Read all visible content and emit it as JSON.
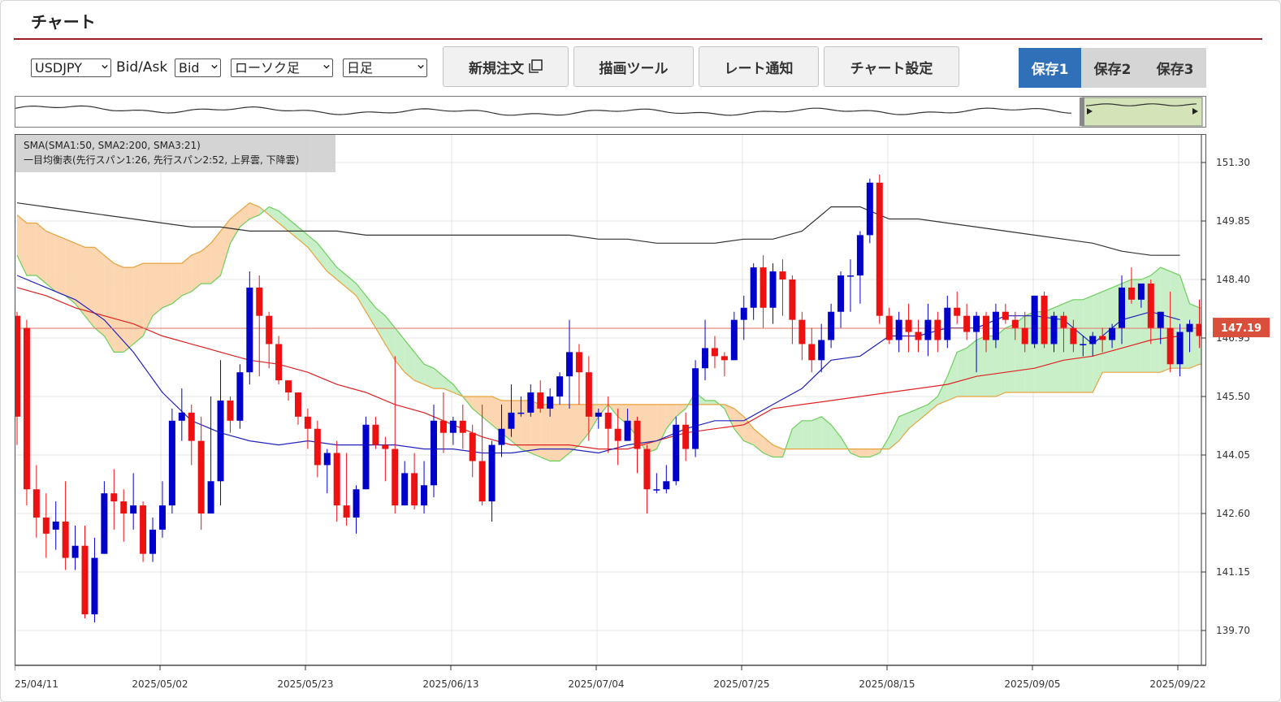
{
  "page": {
    "title": "チャート"
  },
  "toolbar": {
    "symbol": "USDJPY",
    "bid_ask_label": "Bid/Ask",
    "price_side": "Bid",
    "chart_type": "ローソク足",
    "period": "日足",
    "new_order": "新規注文",
    "drawing_tools": "描画ツール",
    "rate_alert": "レート通知",
    "chart_settings": "チャート設定",
    "save1": "保存1",
    "save2": "保存2",
    "save3": "保存3"
  },
  "legend": {
    "line1": "SMA(SMA1:50, SMA2:200, SMA3:21)",
    "line2": "一目均衡表(先行スパン1:26, 先行スパン2:52, 上昇雲, 下降雲)"
  },
  "colors": {
    "up": "#0000cc",
    "down": "#ee1111",
    "accent": "#3070b8",
    "title_rule": "#a01c1c",
    "price_tag": "#d94f3b",
    "sma50": "#dd2222",
    "sma200": "#333333",
    "sma21": "#2222bb",
    "cloud_up": "#c8efc8",
    "cloud_down": "#fbd6b0"
  },
  "chart_data": {
    "type": "candlestick",
    "symbol": "USDJPY",
    "timeframe": "日足",
    "current_price": "147.19",
    "y_ticks": [
      "151.30",
      "149.85",
      "148.40",
      "146.95",
      "145.50",
      "144.05",
      "142.60",
      "141.15",
      "139.70"
    ],
    "x_ticks": [
      "2025/04/11",
      "2025/05/02",
      "2025/05/23",
      "2025/06/13",
      "2025/07/04",
      "2025/07/25",
      "2025/08/15",
      "2025/09/05",
      "2025/09/22"
    ],
    "ylim": [
      139.3,
      151.6
    ],
    "candles": [
      [
        147.5,
        145.0,
        147.6,
        144.3
      ],
      [
        147.2,
        143.2,
        147.4,
        142.8
      ],
      [
        143.2,
        142.5,
        143.8,
        142.0
      ],
      [
        142.5,
        142.1,
        143.1,
        141.5
      ],
      [
        142.2,
        142.4,
        142.9,
        141.7
      ],
      [
        142.4,
        141.5,
        143.4,
        141.2
      ],
      [
        141.5,
        141.8,
        142.3,
        141.2
      ],
      [
        141.8,
        140.1,
        142.3,
        140.0
      ],
      [
        140.1,
        141.5,
        142.0,
        139.9
      ],
      [
        141.6,
        143.1,
        143.4,
        141.6
      ],
      [
        143.1,
        142.9,
        143.7,
        142.2
      ],
      [
        142.9,
        142.6,
        143.2,
        141.9
      ],
      [
        142.6,
        142.8,
        143.6,
        142.2
      ],
      [
        142.8,
        141.6,
        142.9,
        141.4
      ],
      [
        141.6,
        142.2,
        142.5,
        141.4
      ],
      [
        142.2,
        142.8,
        143.4,
        142.0
      ],
      [
        142.8,
        144.9,
        145.2,
        142.6
      ],
      [
        144.9,
        145.1,
        145.7,
        144.4
      ],
      [
        145.1,
        144.4,
        145.3,
        143.8
      ],
      [
        144.4,
        142.6,
        145.0,
        142.2
      ],
      [
        142.6,
        143.4,
        145.5,
        142.6
      ],
      [
        143.4,
        145.4,
        146.4,
        142.8
      ],
      [
        145.4,
        144.9,
        145.5,
        144.6
      ],
      [
        144.9,
        146.1,
        146.3,
        144.7
      ],
      [
        146.1,
        148.2,
        148.6,
        145.8
      ],
      [
        148.2,
        147.5,
        148.5,
        146.0
      ],
      [
        147.5,
        146.8,
        147.6,
        146.2
      ],
      [
        146.8,
        145.9,
        147.0,
        145.8
      ],
      [
        145.9,
        145.6,
        145.9,
        145.4
      ],
      [
        145.6,
        145.0,
        145.6,
        144.8
      ],
      [
        145.0,
        144.7,
        145.2,
        144.2
      ],
      [
        144.7,
        143.8,
        144.9,
        143.5
      ],
      [
        143.8,
        144.1,
        144.2,
        143.1
      ],
      [
        144.1,
        142.8,
        144.4,
        142.4
      ],
      [
        142.8,
        142.5,
        144.1,
        142.3
      ],
      [
        142.5,
        143.2,
        143.3,
        142.1
      ],
      [
        143.2,
        144.8,
        145.0,
        143.2
      ],
      [
        144.8,
        144.3,
        145.0,
        144.2
      ],
      [
        144.3,
        144.2,
        144.5,
        143.4
      ],
      [
        144.2,
        142.8,
        146.5,
        142.6
      ],
      [
        142.8,
        143.6,
        143.9,
        142.8
      ],
      [
        143.6,
        142.8,
        144.1,
        142.7
      ],
      [
        142.8,
        143.3,
        143.9,
        142.6
      ],
      [
        143.3,
        144.9,
        145.3,
        143.0
      ],
      [
        144.9,
        144.6,
        145.6,
        144.1
      ],
      [
        144.6,
        144.9,
        145.0,
        144.3
      ],
      [
        144.9,
        144.6,
        145.3,
        144.2
      ],
      [
        144.6,
        143.9,
        144.8,
        143.5
      ],
      [
        143.9,
        142.9,
        145.3,
        142.8
      ],
      [
        142.9,
        144.3,
        144.4,
        142.4
      ],
      [
        144.3,
        144.7,
        145.3,
        144.0
      ],
      [
        144.7,
        145.1,
        145.8,
        144.5
      ],
      [
        145.1,
        145.1,
        145.5,
        145.0
      ],
      [
        145.1,
        145.6,
        145.8,
        145.0
      ],
      [
        145.6,
        145.2,
        145.9,
        145.1
      ],
      [
        145.2,
        145.5,
        145.7,
        145.0
      ],
      [
        145.5,
        146.0,
        146.1,
        145.3
      ],
      [
        146.0,
        146.6,
        147.4,
        145.2
      ],
      [
        146.6,
        146.1,
        146.8,
        145.3
      ],
      [
        146.1,
        145.0,
        146.5,
        144.4
      ],
      [
        145.0,
        145.1,
        145.2,
        144.7
      ],
      [
        145.1,
        144.7,
        145.5,
        144.1
      ],
      [
        144.7,
        144.4,
        145.2,
        143.8
      ],
      [
        144.4,
        144.9,
        145.2,
        144.4
      ],
      [
        144.9,
        144.2,
        145.0,
        143.6
      ],
      [
        144.2,
        143.2,
        144.3,
        142.6
      ],
      [
        143.2,
        143.2,
        143.6,
        143.1
      ],
      [
        143.2,
        143.4,
        143.8,
        143.1
      ],
      [
        143.4,
        144.8,
        145.0,
        143.3
      ],
      [
        144.8,
        144.2,
        145.1,
        143.9
      ],
      [
        144.2,
        146.2,
        146.4,
        144.0
      ],
      [
        146.2,
        146.7,
        147.4,
        145.9
      ],
      [
        146.7,
        146.5,
        147.0,
        146.2
      ],
      [
        146.5,
        146.4,
        146.6,
        146.0
      ],
      [
        146.4,
        147.4,
        147.6,
        146.4
      ],
      [
        147.4,
        147.7,
        148.0,
        146.9
      ],
      [
        147.7,
        148.7,
        148.8,
        147.4
      ],
      [
        148.7,
        147.7,
        149.0,
        147.2
      ],
      [
        147.7,
        148.6,
        148.8,
        147.3
      ],
      [
        148.6,
        148.4,
        148.9,
        147.5
      ],
      [
        148.4,
        147.4,
        148.5,
        146.8
      ],
      [
        147.4,
        146.8,
        147.6,
        146.4
      ],
      [
        146.8,
        146.4,
        147.2,
        146.1
      ],
      [
        146.4,
        146.9,
        147.3,
        146.1
      ],
      [
        146.9,
        147.6,
        147.8,
        146.7
      ],
      [
        147.6,
        148.5,
        148.6,
        147.2
      ],
      [
        148.5,
        148.5,
        148.9,
        147.6
      ],
      [
        148.5,
        149.5,
        149.6,
        147.8
      ],
      [
        149.5,
        150.8,
        150.9,
        149.3
      ],
      [
        150.8,
        147.5,
        151.0,
        147.3
      ],
      [
        147.5,
        146.9,
        147.7,
        146.8
      ],
      [
        146.9,
        147.4,
        147.6,
        146.6
      ],
      [
        147.4,
        147.1,
        147.8,
        146.6
      ],
      [
        147.1,
        146.9,
        147.4,
        146.6
      ],
      [
        146.9,
        147.4,
        147.8,
        146.5
      ],
      [
        147.4,
        146.9,
        147.6,
        146.6
      ],
      [
        146.9,
        147.7,
        148.0,
        146.7
      ],
      [
        147.7,
        147.5,
        148.1,
        147.3
      ],
      [
        147.5,
        147.1,
        147.8,
        146.9
      ],
      [
        147.1,
        147.5,
        147.6,
        146.1
      ],
      [
        147.5,
        146.9,
        147.6,
        146.6
      ],
      [
        146.9,
        147.6,
        147.8,
        146.7
      ],
      [
        147.6,
        147.4,
        147.8,
        147.3
      ],
      [
        147.4,
        147.2,
        147.6,
        146.9
      ],
      [
        147.2,
        146.8,
        147.6,
        146.6
      ],
      [
        146.8,
        148.0,
        148.0,
        146.7
      ],
      [
        148.0,
        146.8,
        148.1,
        146.7
      ],
      [
        146.8,
        147.5,
        147.6,
        146.6
      ],
      [
        147.5,
        147.2,
        147.6,
        146.6
      ],
      [
        147.2,
        146.8,
        147.4,
        146.6
      ],
      [
        146.8,
        146.8,
        147.0,
        146.5
      ],
      [
        146.8,
        147.0,
        147.1,
        146.5
      ],
      [
        147.0,
        146.9,
        147.2,
        146.6
      ],
      [
        146.9,
        147.2,
        147.3,
        146.7
      ],
      [
        147.2,
        148.2,
        148.5,
        146.8
      ],
      [
        148.2,
        147.9,
        148.7,
        147.8
      ],
      [
        147.9,
        148.3,
        148.3,
        147.7
      ],
      [
        148.3,
        147.2,
        148.4,
        146.8
      ],
      [
        147.2,
        147.6,
        147.6,
        146.8
      ],
      [
        147.2,
        146.3,
        148.1,
        146.1
      ],
      [
        146.3,
        147.1,
        147.3,
        146.0
      ],
      [
        147.1,
        147.3,
        147.4,
        146.6
      ],
      [
        147.3,
        147.0,
        147.9,
        146.7
      ],
      [
        147.0,
        147.2,
        147.3,
        146.9
      ]
    ],
    "sma200": [
      150.3,
      150.2,
      150.1,
      150.0,
      149.9,
      149.8,
      149.7,
      149.7,
      149.6,
      149.6,
      149.6,
      149.6,
      149.5,
      149.5,
      149.5,
      149.5,
      149.5,
      149.5,
      149.5,
      149.5,
      149.4,
      149.4,
      149.3,
      149.3,
      149.3,
      149.4,
      149.4,
      149.6,
      150.2,
      150.2,
      149.9,
      149.9,
      149.8,
      149.7,
      149.6,
      149.5,
      149.4,
      149.3,
      149.1,
      149.0,
      149.0
    ],
    "sma50": [
      148.2,
      148.0,
      147.7,
      147.5,
      147.3,
      147.0,
      146.8,
      146.6,
      146.4,
      146.3,
      146.1,
      145.8,
      145.6,
      145.3,
      145.1,
      144.8,
      144.5,
      144.3,
      144.3,
      144.3,
      144.2,
      144.2,
      144.4,
      144.6,
      144.7,
      144.8,
      145.2,
      145.3,
      145.4,
      145.5,
      145.6,
      145.7,
      145.8,
      146.0,
      146.1,
      146.2,
      146.4,
      146.5,
      146.7,
      146.9,
      147.0
    ],
    "sma21": [
      148.5,
      148.2,
      147.9,
      147.4,
      146.6,
      145.6,
      144.9,
      144.6,
      144.4,
      144.3,
      144.4,
      144.3,
      144.3,
      144.3,
      144.2,
      144.2,
      144.1,
      144.1,
      144.2,
      144.2,
      144.1,
      144.3,
      144.4,
      144.7,
      144.9,
      144.9,
      145.3,
      145.7,
      146.4,
      146.5,
      147.0,
      147.0,
      147.2,
      147.2,
      147.5,
      147.5,
      147.4,
      146.8,
      147.4,
      147.6,
      147.4
    ],
    "senkou_a": [
      149.0,
      148.5,
      148.5,
      148.3,
      148.1,
      148.0,
      147.8,
      147.5,
      147.2,
      147.0,
      146.6,
      146.6,
      146.8,
      147.0,
      147.5,
      147.7,
      147.8,
      148.0,
      148.1,
      148.3,
      148.3,
      148.5,
      149.3,
      149.7,
      149.9,
      150.0,
      150.2,
      150.1,
      149.9,
      149.7,
      149.5,
      149.3,
      149.0,
      148.7,
      148.5,
      148.3,
      148.0,
      147.7,
      147.5,
      147.2,
      146.9,
      146.6,
      146.3,
      146.2,
      146.0,
      145.8,
      145.5,
      145.2,
      145.0,
      144.8,
      144.6,
      144.4,
      144.2,
      144.1,
      144.0,
      143.9,
      143.9,
      144.1,
      144.3,
      144.6,
      145.0,
      145.3,
      145.0,
      144.8,
      144.5,
      144.1,
      144.2,
      144.7,
      145.0,
      145.2,
      145.6,
      145.4,
      145.4,
      145.2,
      144.7,
      144.4,
      144.3,
      144.1,
      144.0,
      144.0,
      144.7,
      144.9,
      144.9,
      145.0,
      144.8,
      144.5,
      144.1,
      144.0,
      144.0,
      144.1,
      144.5,
      145.0,
      145.1,
      145.2,
      145.3,
      145.5,
      146.0,
      146.6,
      146.7,
      146.9,
      147.0,
      147.0,
      147.2,
      147.3,
      147.5,
      147.6,
      147.6,
      147.7,
      147.8,
      147.9,
      147.9,
      148.0,
      148.1,
      148.2,
      148.3,
      148.4,
      148.4,
      148.5,
      148.7,
      148.6,
      148.5,
      147.8,
      147.7,
      147.7,
      147.7,
      147.8
    ],
    "senkou_b": [
      150.0,
      149.8,
      149.8,
      149.6,
      149.5,
      149.4,
      149.3,
      149.2,
      149.2,
      149.0,
      148.8,
      148.7,
      148.7,
      148.8,
      148.8,
      148.8,
      148.8,
      148.8,
      149.0,
      149.1,
      149.3,
      149.6,
      149.9,
      150.1,
      150.3,
      150.2,
      150.0,
      149.8,
      149.6,
      149.4,
      149.2,
      148.9,
      148.6,
      148.4,
      148.2,
      148.0,
      147.6,
      147.2,
      146.8,
      146.4,
      146.1,
      145.9,
      145.8,
      145.7,
      145.7,
      145.6,
      145.5,
      145.5,
      145.5,
      145.5,
      145.4,
      145.4,
      145.4,
      145.4,
      145.3,
      145.3,
      145.3,
      145.3,
      145.3,
      145.3,
      145.3,
      145.3,
      145.3,
      145.3,
      145.3,
      145.3,
      145.3,
      145.3,
      145.3,
      145.3,
      145.3,
      145.3,
      145.3,
      145.3,
      145.2,
      145.0,
      144.7,
      144.5,
      144.3,
      144.2,
      144.2,
      144.2,
      144.2,
      144.2,
      144.2,
      144.2,
      144.2,
      144.2,
      144.2,
      144.2,
      144.2,
      144.4,
      144.7,
      144.9,
      145.1,
      145.3,
      145.4,
      145.5,
      145.5,
      145.5,
      145.5,
      145.5,
      145.6,
      145.6,
      145.6,
      145.6,
      145.6,
      145.6,
      145.6,
      145.6,
      145.6,
      145.6,
      146.1,
      146.1,
      146.1,
      146.1,
      146.1,
      146.1,
      146.1,
      146.2,
      146.2,
      146.2,
      146.3,
      146.3,
      146.3,
      146.3
    ]
  }
}
